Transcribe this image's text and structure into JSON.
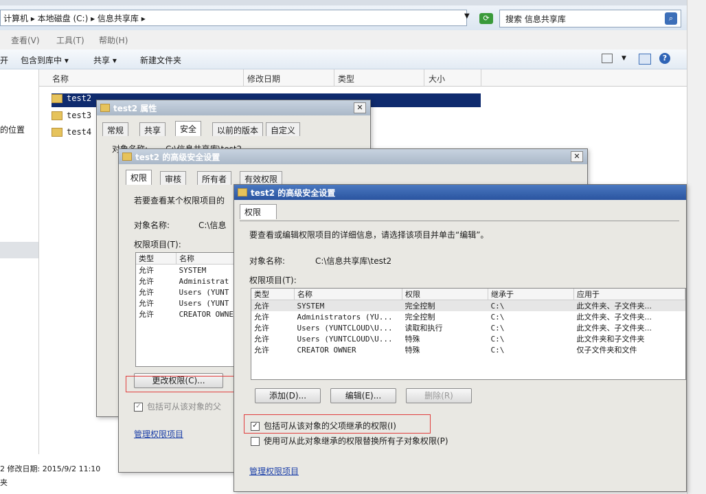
{
  "explorer": {
    "breadcrumb": "计算机 ▸ 本地磁盘 (C:) ▸ 信息共享库 ▸",
    "search_placeholder": "搜索 信息共享库",
    "menu": [
      "查看(V)",
      "工具(T)",
      "帮助(H)"
    ],
    "toolbar": [
      "开",
      "包含到库中 ▾",
      "共享 ▾",
      "新建文件夹"
    ],
    "left_pane_item": "的位置",
    "columns": [
      "名称",
      "修改日期",
      "类型",
      "大小"
    ],
    "files": [
      "test2",
      "test3",
      "test4"
    ],
    "status_line1": "2  修改日期: 2015/9/2 11:10",
    "status_line2": "夹"
  },
  "props": {
    "title": "test2 属性",
    "tabs": [
      "常规",
      "共享",
      "安全",
      "以前的版本",
      "自定义"
    ],
    "object_label": "对象名称:",
    "object_value": "C:\\信息共享库\\test2"
  },
  "adv1": {
    "title": "test2 的高级安全设置",
    "tabs": [
      "权限",
      "审核",
      "所有者",
      "有效权限"
    ],
    "desc": "若要查看某个权限项目的",
    "object_label": "对象名称:",
    "object_value": "C:\\信息",
    "entries_label": "权限项目(T):",
    "col_type": "类型",
    "col_name": "名称",
    "rows": [
      {
        "type": "允许",
        "name": "SYSTEM"
      },
      {
        "type": "允许",
        "name": "Administrat"
      },
      {
        "type": "允许",
        "name": "Users (YUNT"
      },
      {
        "type": "允许",
        "name": "Users (YUNT"
      },
      {
        "type": "允许",
        "name": "CREATOR OWNE"
      }
    ],
    "change_btn": "更改权限(C)...",
    "inherit_label": "包括可从该对象的父",
    "manage_link": "管理权限项目"
  },
  "adv2": {
    "title": "test2 的高级安全设置",
    "tab": "权限",
    "desc": "要查看或编辑权限项目的详细信息，请选择该项目并单击“编辑”。",
    "object_label": "对象名称:",
    "object_value": "C:\\信息共享库\\test2",
    "entries_label": "权限项目(T):",
    "columns": [
      "类型",
      "名称",
      "权限",
      "继承于",
      "应用于"
    ],
    "rows": [
      {
        "type": "允许",
        "name": "SYSTEM",
        "perm": "完全控制",
        "from": "C:\\",
        "apply": "此文件夹、子文件夹..."
      },
      {
        "type": "允许",
        "name": "Administrators (YU...",
        "perm": "完全控制",
        "from": "C:\\",
        "apply": "此文件夹、子文件夹..."
      },
      {
        "type": "允许",
        "name": "Users (YUNTCLOUD\\U...",
        "perm": "读取和执行",
        "from": "C:\\",
        "apply": "此文件夹、子文件夹..."
      },
      {
        "type": "允许",
        "name": "Users (YUNTCLOUD\\U...",
        "perm": "特殊",
        "from": "C:\\",
        "apply": "此文件夹和子文件夹"
      },
      {
        "type": "允许",
        "name": "CREATOR OWNER",
        "perm": "特殊",
        "from": "C:\\",
        "apply": "仅子文件夹和文件"
      }
    ],
    "add_btn": "添加(D)...",
    "edit_btn": "编辑(E)...",
    "delete_btn": "删除(R)",
    "inherit_label": "包括可从该对象的父项继承的权限(I)",
    "replace_label": "使用可从此对象继承的权限替换所有子对象权限(P)",
    "manage_link": "管理权限项目"
  }
}
